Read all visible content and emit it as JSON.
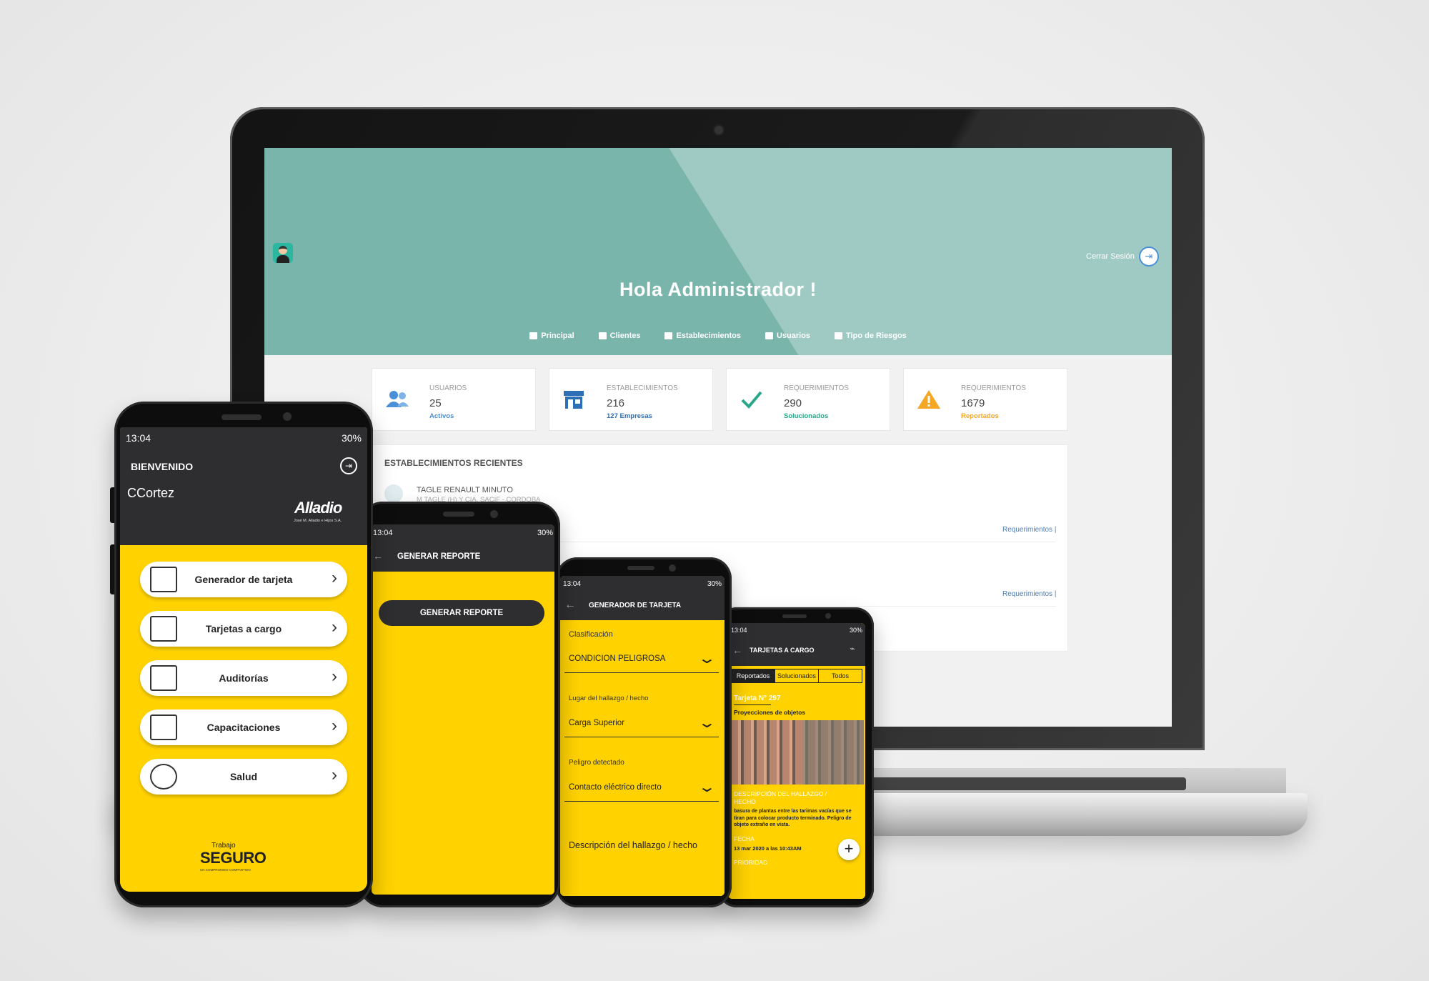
{
  "web": {
    "greeting": "Hola Administrador !",
    "logout_label": "Cerrar Sesión",
    "nav": [
      "Principal",
      "Clientes",
      "Establecimientos",
      "Usuarios",
      "Tipo de Riesgos"
    ],
    "stats": [
      {
        "label": "USUARIOS",
        "value": "25",
        "sub": "Activos",
        "color": "#4a90d9",
        "icon": "users-icon"
      },
      {
        "label": "ESTABLECIMIENTOS",
        "value": "216",
        "sub": "127 Empresas",
        "color": "#2d6fb5",
        "icon": "store-icon"
      },
      {
        "label": "REQUERIMIENTOS",
        "value": "290",
        "sub": "Solucionados",
        "color": "#2aa78a",
        "icon": "check-icon"
      },
      {
        "label": "REQUERIMIENTOS",
        "value": "1679",
        "sub": "Reportados",
        "color": "#f5a623",
        "icon": "warning-icon"
      }
    ],
    "recent_title": "ESTABLECIMIENTOS RECIENTES",
    "recent": [
      {
        "name": "TAGLE RENAULT MINUTO",
        "sub": "M TAGLE (H) Y CIA. SACIF - CORDOBA",
        "link": "Requerimientos |"
      },
      {
        "name": "",
        "sub": "",
        "link": "Requerimientos |"
      }
    ]
  },
  "phone1": {
    "time": "13:04",
    "battery": "30%",
    "welcome": "BIENVENIDO",
    "user": "CCortez",
    "brand_logo": "Alladio",
    "brand_sub": "José M. Alladio e Hijos S.A.",
    "menu": [
      "Generador de tarjeta",
      "Tarjetas a cargo",
      "Auditorías",
      "Capacitaciones",
      "Salud"
    ],
    "footer_small": "Trabajo",
    "footer_big": "SEGURO",
    "footer_tag": "UN COMPROMISO COMPARTIDO"
  },
  "phone2": {
    "time": "13:04",
    "battery": "30%",
    "title": "GENERAR REPORTE",
    "button": "GENERAR REPORTE"
  },
  "phone3": {
    "time": "13:04",
    "battery": "30%",
    "title": "GENERADOR DE TARJETA",
    "fields": [
      {
        "label": "Clasificación",
        "value": "CONDICION PELIGROSA"
      },
      {
        "label": "Lugar del hallazgo / hecho",
        "value": "Carga Superior"
      },
      {
        "label": "Peligro detectado",
        "value": "Contacto eléctrico directo"
      }
    ],
    "description_label": "Descripción del hallazgo / hecho"
  },
  "phone4": {
    "time": "13:04",
    "battery": "30%",
    "title": "TARJETAS A CARGO",
    "tabs": [
      "Reportados",
      "Solucionados",
      "Todos"
    ],
    "active_tab": "Reportados",
    "card_title": "Tarjeta N° 297",
    "card_subtitle": "Proyecciones de objetos",
    "desc_label": "DESCRIPCIÓN DEL HALLAZGO / HECHO",
    "desc_text": "basura de plantas entre las tarimas vacías que se tiran para colocar producto terminado. Peligro de objeto extraño en vista.",
    "date_label": "FECHA",
    "date_value": "13 mar 2020 a las 10:43AM",
    "priority_label": "PRIORIDAD",
    "fab": "+"
  }
}
